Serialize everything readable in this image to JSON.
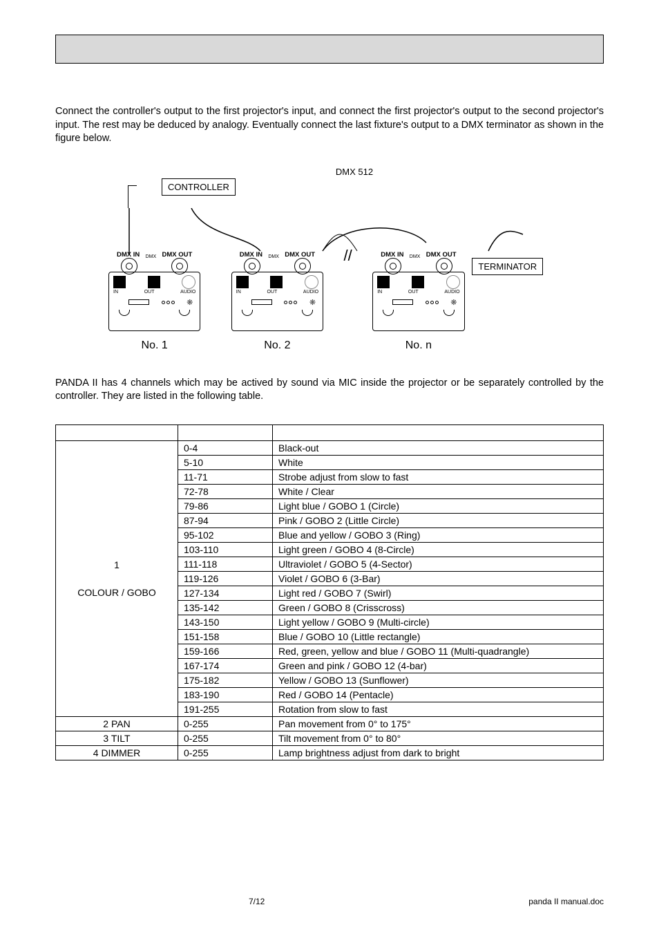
{
  "para1": "Connect the controller's output to the first projector's input, and connect the first projector's output to the second projector's input. The rest may be deduced by analogy. Eventually connect the last fixture's output to a DMX terminator as shown in the figure below.",
  "para2": "PANDA II has 4 channels which may be actived by sound via MIC inside the projector or be separately controlled by the controller. They are listed in the following table.",
  "diagram": {
    "dmx512": "DMX 512",
    "controller": "CONTROLLER",
    "dmx_in": "DMX IN",
    "dmx_out": "DMX OUT",
    "dmx_small": "DMX",
    "in": "IN",
    "out": "OUT",
    "audio": "AUDIO",
    "terminator": "TERMINATOR",
    "no1": "No. 1",
    "no2": "No. 2",
    "non": "No. n",
    "break": "//"
  },
  "table": {
    "ch1": {
      "label": "1",
      "sublabel": "COLOUR / GOBO",
      "rows": [
        {
          "val": "0-4",
          "desc": "Black-out"
        },
        {
          "val": "5-10",
          "desc": "White"
        },
        {
          "val": "11-71",
          "desc": "Strobe adjust from slow to fast"
        },
        {
          "val": "72-78",
          "desc": "White / Clear"
        },
        {
          "val": "79-86",
          "desc": "Light blue / GOBO 1 (Circle)"
        },
        {
          "val": "87-94",
          "desc": "Pink / GOBO 2 (Little Circle)"
        },
        {
          "val": "95-102",
          "desc": "Blue and yellow / GOBO 3 (Ring)"
        },
        {
          "val": "103-110",
          "desc": "Light green / GOBO 4 (8-Circle)"
        },
        {
          "val": "111-118",
          "desc": "Ultraviolet / GOBO 5 (4-Sector)"
        },
        {
          "val": "119-126",
          "desc": "Violet / GOBO 6 (3-Bar)"
        },
        {
          "val": "127-134",
          "desc": "Light red / GOBO 7 (Swirl)"
        },
        {
          "val": "135-142",
          "desc": "Green / GOBO 8 (Crisscross)"
        },
        {
          "val": "143-150",
          "desc": "Light yellow / GOBO 9 (Multi-circle)"
        },
        {
          "val": "151-158",
          "desc": "Blue / GOBO 10 (Little rectangle)"
        },
        {
          "val": "159-166",
          "desc": "Red, green, yellow and blue / GOBO 11 (Multi-quadrangle)"
        },
        {
          "val": "167-174",
          "desc": "Green and pink / GOBO 12 (4-bar)"
        },
        {
          "val": "175-182",
          "desc": "Yellow / GOBO 13 (Sunflower)"
        },
        {
          "val": "183-190",
          "desc": "Red / GOBO 14 (Pentacle)"
        },
        {
          "val": "191-255",
          "desc": "Rotation from slow to fast"
        }
      ]
    },
    "ch2": {
      "label": "2 PAN",
      "val": "0-255",
      "desc": "Pan movement from 0° to 175°"
    },
    "ch3": {
      "label": "3 TILT",
      "val": "0-255",
      "desc": "Tilt movement from 0°  to 80°"
    },
    "ch4": {
      "label": "4 DIMMER",
      "val": "0-255",
      "desc": "Lamp brightness adjust from dark to bright"
    }
  },
  "footer": {
    "page": "7/12",
    "doc": "panda II  manual.doc"
  }
}
